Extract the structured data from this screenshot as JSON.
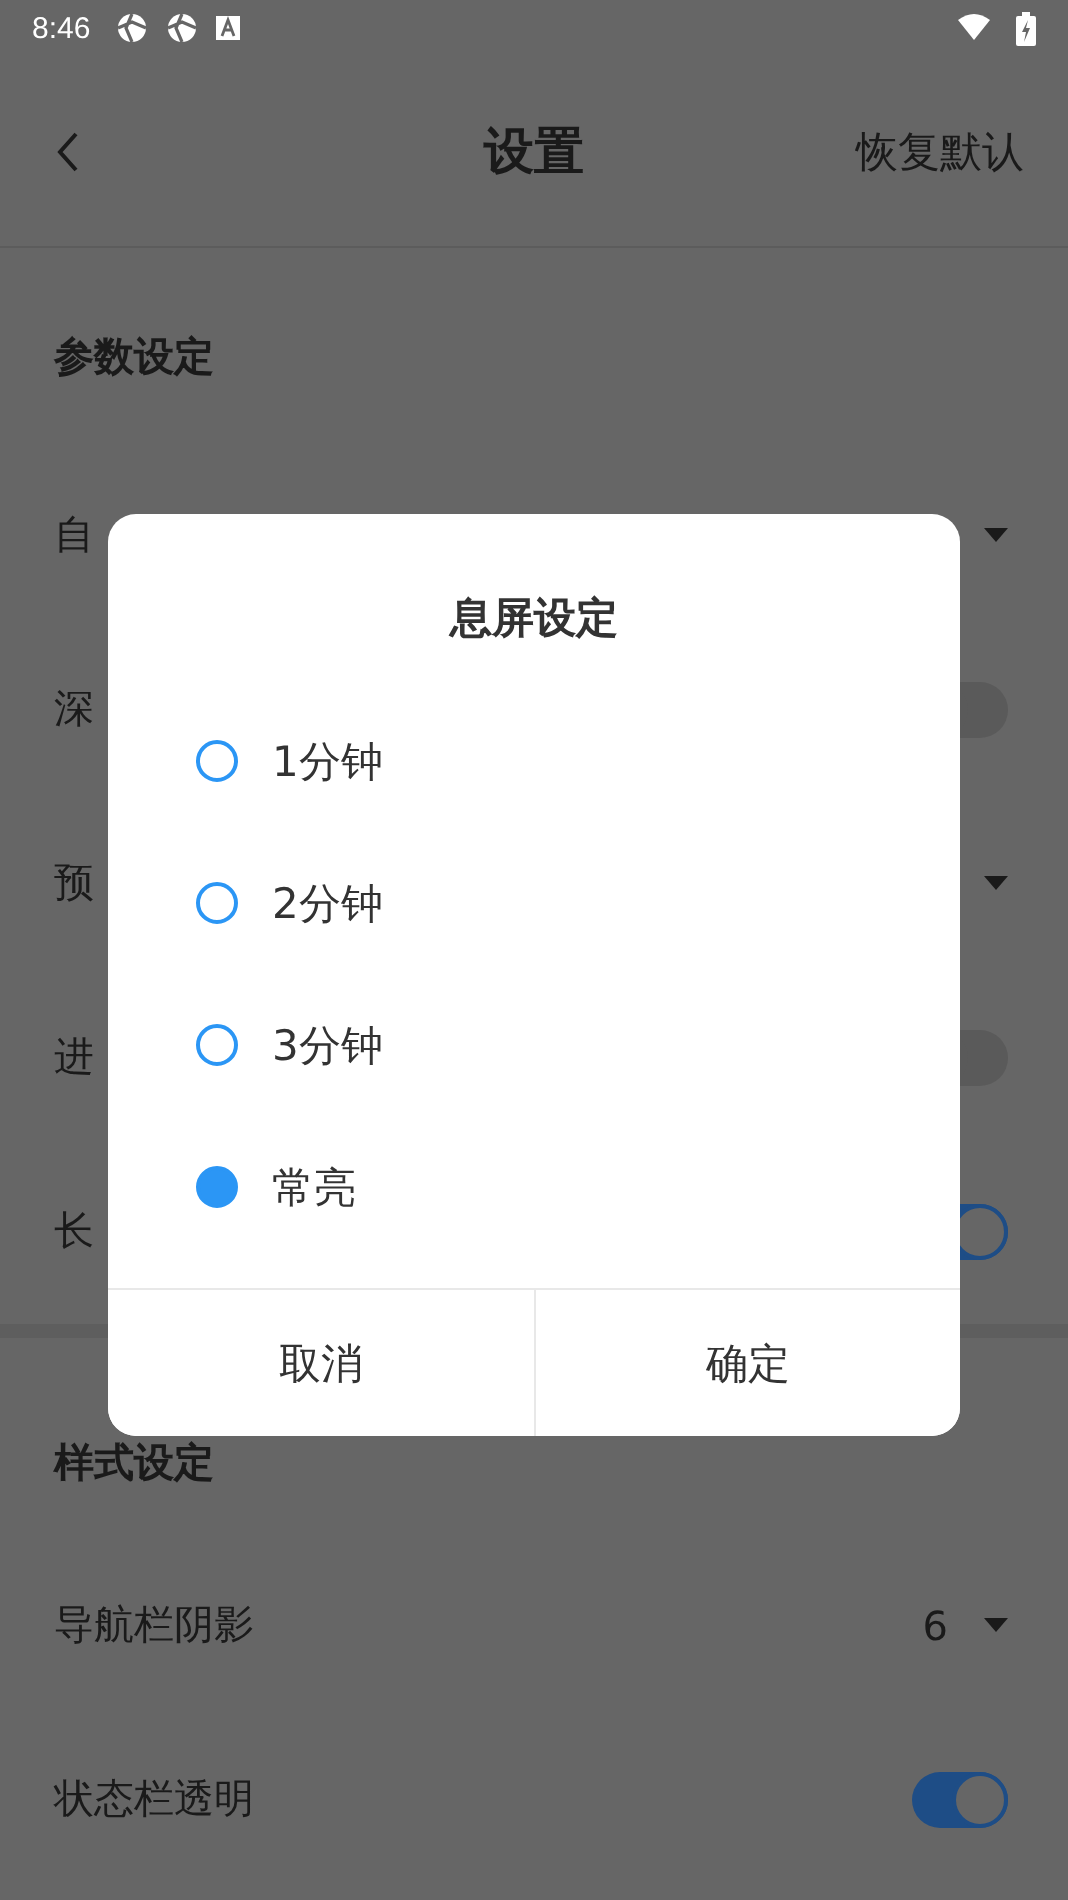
{
  "status_bar": {
    "time": "8:46"
  },
  "header": {
    "title": "设置",
    "action": "恢复默认"
  },
  "sections": [
    {
      "title": "参数设定",
      "rows": [
        {
          "label": "自",
          "kind": "dropdown"
        },
        {
          "label": "深",
          "kind": "toggle",
          "on": false
        },
        {
          "label": "预",
          "kind": "dropdown"
        },
        {
          "label": "进",
          "kind": "toggle",
          "on": false
        },
        {
          "label": "长",
          "kind": "toggle",
          "on": true
        }
      ]
    },
    {
      "title": "样式设定",
      "rows": [
        {
          "label": "导航栏阴影",
          "kind": "dropdown",
          "value": "6"
        },
        {
          "label": "状态栏透明",
          "kind": "toggle",
          "on": true
        }
      ]
    }
  ],
  "dialog": {
    "title": "息屏设定",
    "options": [
      {
        "label": "1分钟",
        "selected": false
      },
      {
        "label": "2分钟",
        "selected": false
      },
      {
        "label": "3分钟",
        "selected": false
      },
      {
        "label": "常亮",
        "selected": true
      }
    ],
    "buttons": [
      "取消",
      "确定"
    ]
  }
}
